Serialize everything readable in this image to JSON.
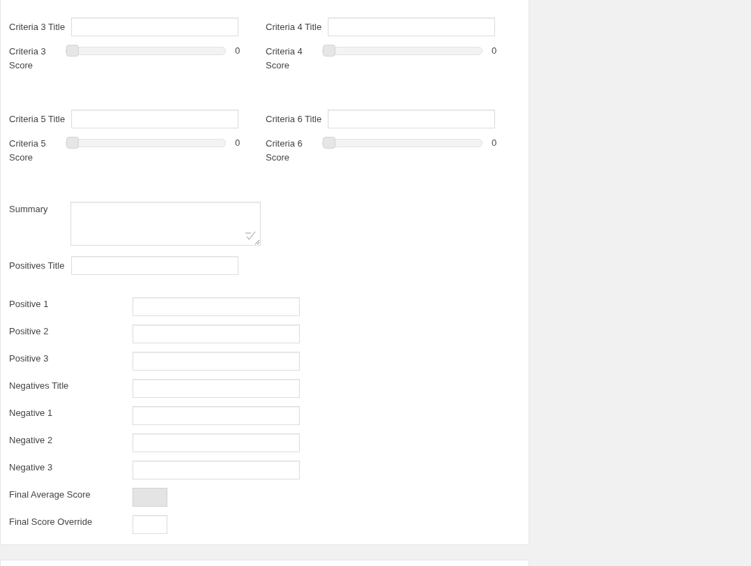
{
  "criteria_rows": [
    {
      "items": [
        {
          "title_label": "Criteria 3 Title",
          "score_label": "Criteria 3 Score",
          "level": 0,
          "reading": "0"
        },
        {
          "title_label": "Criteria 4 Title",
          "score_label": "Criteria 4 Score",
          "level": 0,
          "reading": "0"
        }
      ]
    },
    {
      "items": [
        {
          "title_label": "Criteria 5 Title",
          "score_label": "Criteria 5 Score",
          "level": 0,
          "reading": "0"
        },
        {
          "title_label": "Criteria 6 Title",
          "score_label": "Criteria 6 Score",
          "level": 0,
          "reading": "0"
        }
      ]
    }
  ],
  "summary": {
    "label": "Summary"
  },
  "positives_title": {
    "label": "Positives Title"
  },
  "fields": [
    {
      "label": "Positive 1",
      "kind": "wide",
      "disabled": false
    },
    {
      "label": "Positive 2",
      "kind": "wide",
      "disabled": false
    },
    {
      "label": "Positive 3",
      "kind": "wide",
      "disabled": false
    },
    {
      "label": "Negatives Title",
      "kind": "wide",
      "disabled": false
    },
    {
      "label": "Negative 1",
      "kind": "wide",
      "disabled": false
    },
    {
      "label": "Negative 2",
      "kind": "wide",
      "disabled": false
    },
    {
      "label": "Negative 3",
      "kind": "wide",
      "disabled": false
    },
    {
      "label": "Final Average Score",
      "kind": "short",
      "disabled": true
    },
    {
      "label": "Final Score Override",
      "kind": "short",
      "disabled": false
    }
  ]
}
